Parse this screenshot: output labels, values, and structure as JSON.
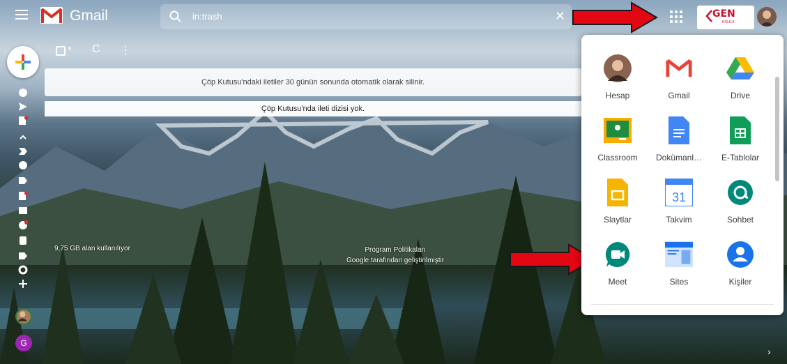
{
  "header": {
    "app_name": "Gmail",
    "search_value": "in:trash",
    "search_clear": "✕",
    "brand_text": "GEN",
    "brand_sub": "KOLEJI"
  },
  "toolbar": {
    "refresh": "C",
    "more": "⋮"
  },
  "notices": {
    "trash_info": "Çöp Kutusu'ndaki iletiler 30 günün sonunda otomatik olarak silinir.",
    "empty": "Çöp Kutusu'nda ileti dizisi yok."
  },
  "footer": {
    "storage": "9,75 GB alan kullanılıyor",
    "policy": "Program Politikaları",
    "powered": "Google tarafından geliştirilmiştir"
  },
  "rail": {
    "g_letter": "G"
  },
  "apps": [
    {
      "label": "Hesap",
      "icon": "account-avatar"
    },
    {
      "label": "Gmail",
      "icon": "gmail-icon"
    },
    {
      "label": "Drive",
      "icon": "drive-icon"
    },
    {
      "label": "Classroom",
      "icon": "classroom-icon"
    },
    {
      "label": "Dokümanl…",
      "icon": "docs-icon"
    },
    {
      "label": "E-Tablolar",
      "icon": "sheets-icon"
    },
    {
      "label": "Slaytlar",
      "icon": "slides-icon"
    },
    {
      "label": "Takvim",
      "icon": "calendar-icon",
      "number": "31"
    },
    {
      "label": "Sohbet",
      "icon": "chat-icon"
    },
    {
      "label": "Meet",
      "icon": "meet-icon"
    },
    {
      "label": "Sites",
      "icon": "sites-icon"
    },
    {
      "label": "Kişiler",
      "icon": "contacts-icon"
    }
  ],
  "colors": {
    "arrow": "#e30613",
    "gmail_red": "#d93025",
    "accent_blue": "#1a73e8"
  }
}
